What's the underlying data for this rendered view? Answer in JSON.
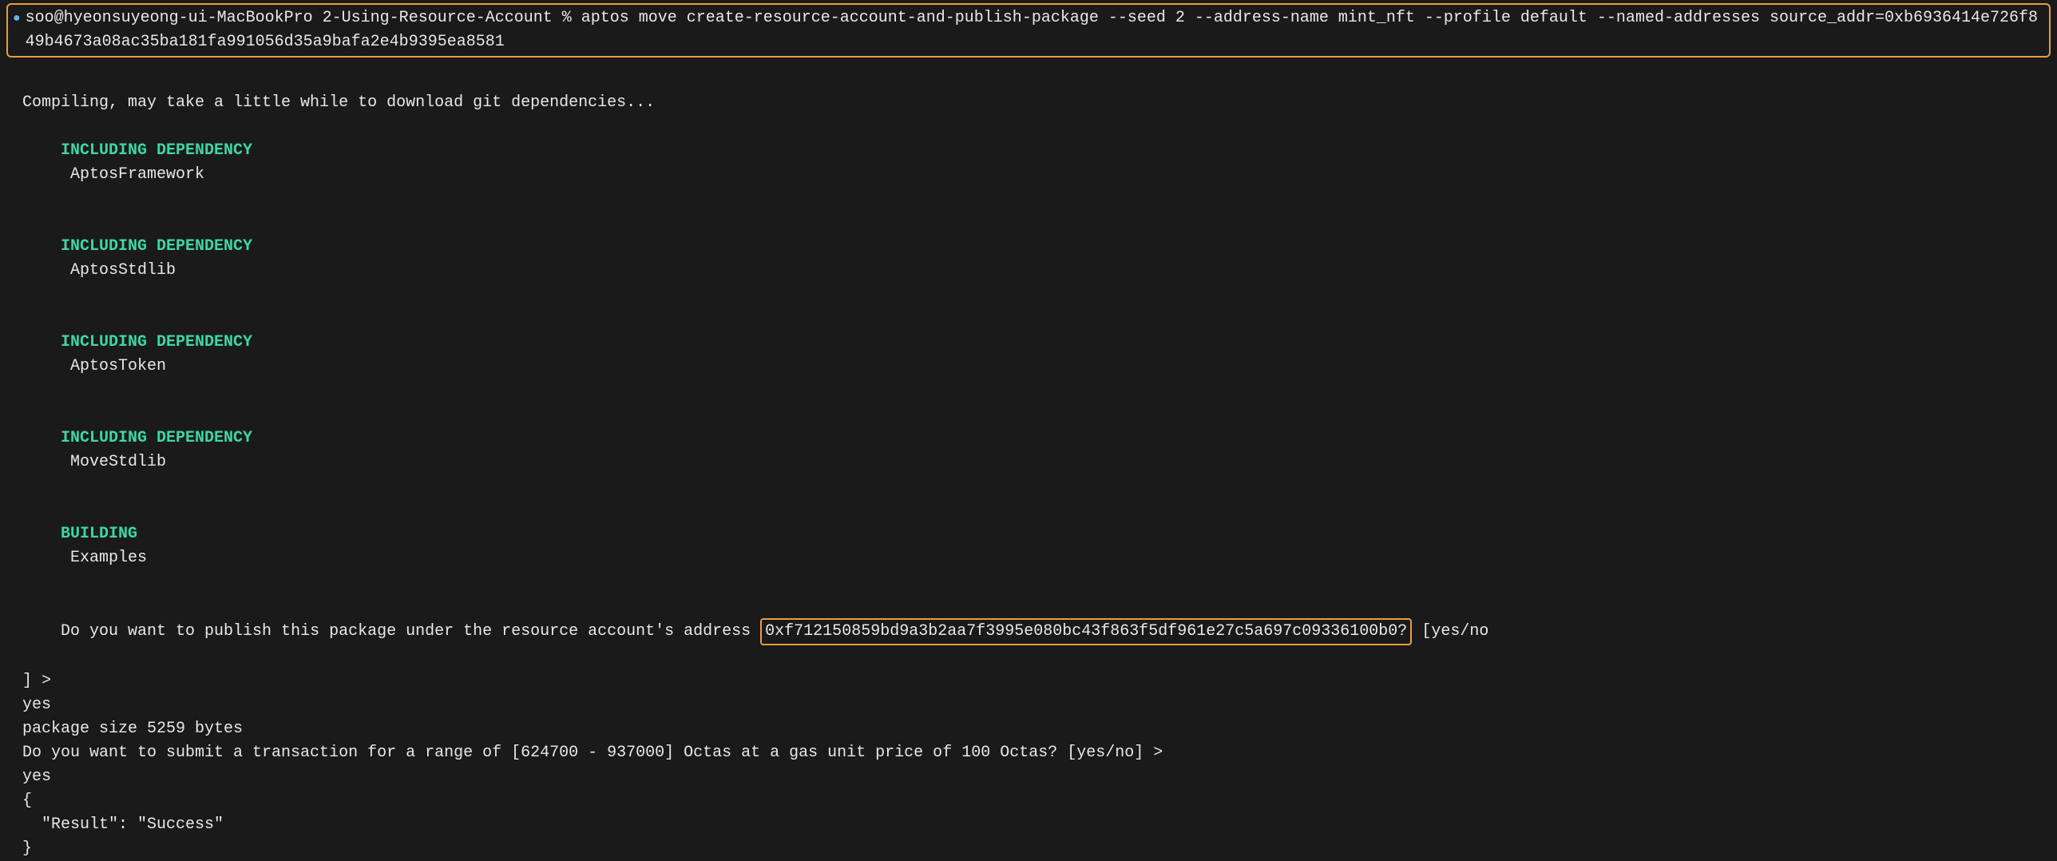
{
  "command": {
    "prompt_indicator": "●",
    "full_text": "soo@hyeonsuyeong-ui-MacBookPro 2-Using-Resource-Account % aptos move create-resource-account-and-publish-package --seed 2 --address-name mint_nft --profile default --named-addresses source_addr=0xb6936414e726f849b4673a08ac35ba181fa991056d35a9bafa2e4b9395ea8581"
  },
  "output": {
    "compiling_msg": "Compiling, may take a little while to download git dependencies...",
    "deps": [
      {
        "prefix": "INCLUDING DEPENDENCY",
        "name": "AptosFramework"
      },
      {
        "prefix": "INCLUDING DEPENDENCY",
        "name": "AptosStdlib"
      },
      {
        "prefix": "INCLUDING DEPENDENCY",
        "name": "AptosToken"
      },
      {
        "prefix": "INCLUDING DEPENDENCY",
        "name": "MoveStdlib"
      }
    ],
    "building": {
      "prefix": "BUILDING",
      "name": "Examples"
    },
    "publish_prompt_before": "Do you want to publish this package under the resource account's address ",
    "publish_address": "0xf712150859bd9a3b2aa7f3995e080bc43f863f5df961e27c5a697c09336100b0?",
    "publish_prompt_after": " [yes/no",
    "publish_prompt_line2": "] >",
    "answer1": "yes",
    "package_size": "package size 5259 bytes",
    "transaction_prompt": "Do you want to submit a transaction for a range of [624700 - 937000] Octas at a gas unit price of 100 Octas? [yes/no] >",
    "answer2": "yes",
    "result_open": "{",
    "result_line": "  \"Result\": \"Success\"",
    "result_close": "}"
  }
}
